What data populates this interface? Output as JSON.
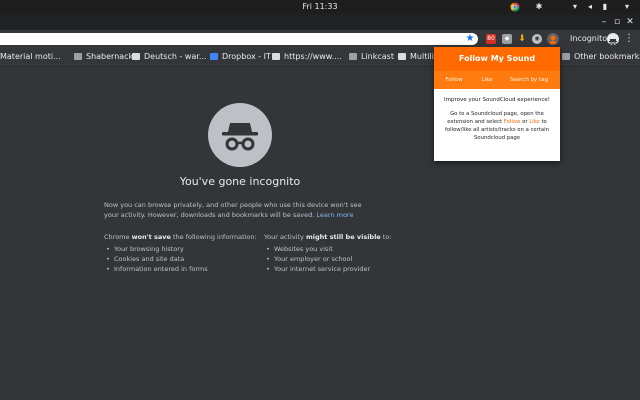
{
  "os": {
    "clock": "Fri 11:33"
  },
  "toolbar": {
    "incognito_label": "Incognito",
    "ext_badge": "80"
  },
  "bookmarks": [
    {
      "label": "Material moti...",
      "icon": "folder-icon"
    },
    {
      "label": "Shabernack",
      "icon": "folder-icon"
    },
    {
      "label": "Deutsch - war...",
      "icon": "doc-icon"
    },
    {
      "label": "Dropbox - IT",
      "icon": "dropbox-icon"
    },
    {
      "label": "https://www....",
      "icon": "doc-icon"
    },
    {
      "label": "Linkcast",
      "icon": "folder-icon"
    },
    {
      "label": "Multilin",
      "icon": "doc-icon"
    }
  ],
  "other_bookmarks": "Other bookmarks",
  "page": {
    "title": "You've gone incognito",
    "description": "Now you can browse privately, and other people who use this device won't see your activity. However, downloads and bookmarks will be saved.",
    "learn_more": "Learn more",
    "col1": {
      "prefix": "Chrome ",
      "bold": "won't save",
      "suffix": " the following information:",
      "items": [
        "Your browsing history",
        "Cookies and site data",
        "Information entered in forms"
      ]
    },
    "col2": {
      "prefix": "Your activity ",
      "bold": "might still be visible",
      "suffix": " to:",
      "items": [
        "Websites you visit",
        "Your employer or school",
        "Your internet service provider"
      ]
    }
  },
  "popup": {
    "title": "Follow My Sound",
    "tabs": [
      "Follow",
      "Like",
      "Search by tag"
    ],
    "improve": "Improve your SoundCloud experience!",
    "text_1": "Go to a Soundcloud page, open the extension and select ",
    "follow_word": "Follow",
    "or": " or ",
    "like_word": "Like",
    "text_2": " to follow/like all artists/tracks on a certain Soundcloud page"
  },
  "colors": {
    "accent_orange": "#ff6a00",
    "page_bg": "#323639",
    "link": "#8ab4f8"
  }
}
